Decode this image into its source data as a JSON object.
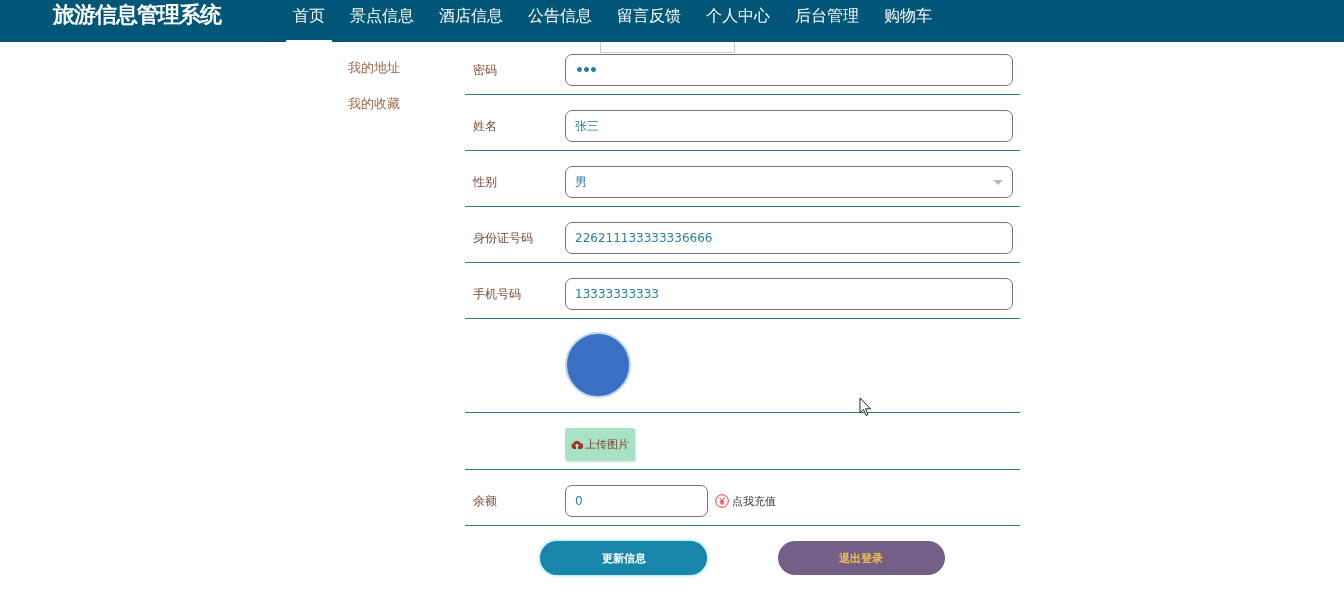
{
  "header": {
    "title": "旅游信息管理系统",
    "nav": [
      {
        "label": "首页",
        "selected": true
      },
      {
        "label": "景点信息",
        "selected": false
      },
      {
        "label": "酒店信息",
        "selected": false
      },
      {
        "label": "公告信息",
        "selected": false
      },
      {
        "label": "留言反馈",
        "selected": false
      },
      {
        "label": "个人中心",
        "selected": false
      },
      {
        "label": "后台管理",
        "selected": false
      },
      {
        "label": "购物车",
        "selected": false
      }
    ]
  },
  "sidebar": {
    "items": [
      {
        "label": "我的地址"
      },
      {
        "label": "我的收藏"
      }
    ]
  },
  "form": {
    "fields": [
      {
        "kind": "password",
        "label": "密码",
        "value": "•••"
      },
      {
        "kind": "text",
        "label": "姓名",
        "value": "张三"
      },
      {
        "kind": "select",
        "label": "性别",
        "value": "男"
      },
      {
        "kind": "text",
        "label": "身份证号码",
        "value": "226211133333336666"
      },
      {
        "kind": "text",
        "label": "手机号码",
        "value": "13333333333"
      },
      {
        "kind": "avatar"
      },
      {
        "kind": "upload",
        "button": "上传图片"
      },
      {
        "kind": "balance",
        "label": "余额",
        "value": "0",
        "link": "点我充值"
      }
    ],
    "buttons": [
      {
        "kind": "primary",
        "label": "更新信息"
      },
      {
        "kind": "secondary",
        "label": "退出登录"
      }
    ]
  }
}
